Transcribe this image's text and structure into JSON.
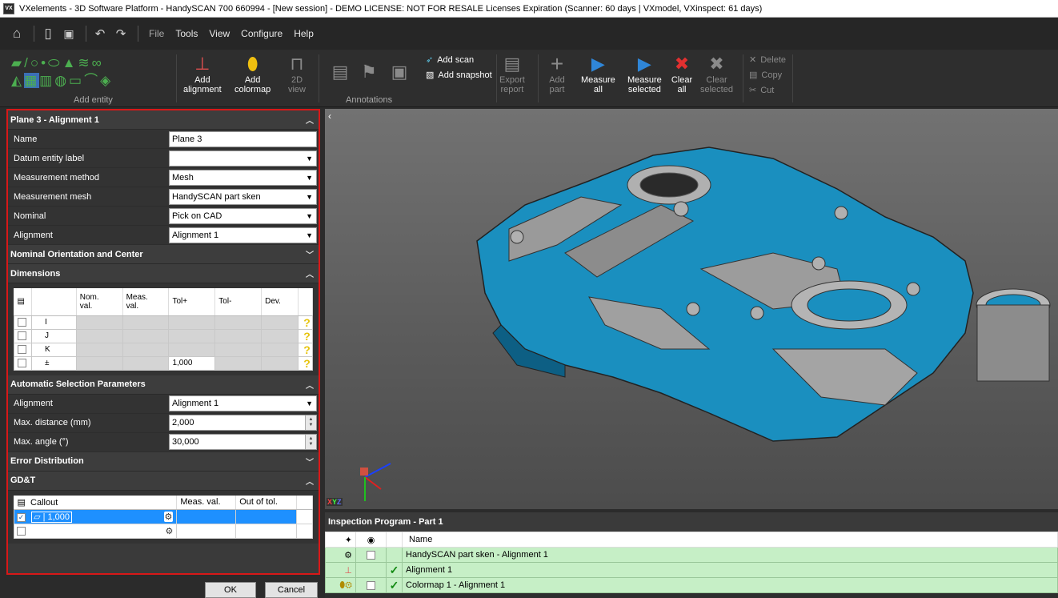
{
  "window": {
    "title": "VXelements - 3D Software Platform - HandySCAN 700 660994 - [New session] - DEMO LICENSE: NOT FOR RESALE Licenses Expiration (Scanner: 60 days | VXmodel, VXinspect: 61 days)",
    "icon": "VX"
  },
  "menu": {
    "items": [
      "File",
      "Tools",
      "View",
      "Configure",
      "Help"
    ],
    "icons": [
      "home-icon",
      "new-document-icon",
      "save-icon",
      "undo-icon",
      "redo-icon"
    ]
  },
  "ribbon": {
    "add_entity_label": "Add entity",
    "add_alignment": "Add\nalignment",
    "add_colormap": "Add\ncolormap",
    "view_2d": "2D\nview",
    "annotations_label": "Annotations",
    "add_scan": "Add scan",
    "add_snapshot": "Add snapshot",
    "export_report": "Export\nreport",
    "add_part": "Add\npart",
    "measure_all": "Measure\nall",
    "measure_selected": "Measure\nselected",
    "clear_all": "Clear\nall",
    "clear_selected": "Clear\nselected",
    "delete": "Delete",
    "copy": "Copy",
    "cut": "Cut"
  },
  "panel": {
    "header": "Plane 3 - Alignment 1",
    "properties": [
      {
        "label": "Name",
        "value": "Plane 3",
        "type": "text"
      },
      {
        "label": "Datum entity label",
        "value": "",
        "type": "dropdown"
      },
      {
        "label": "Measurement method",
        "value": "Mesh",
        "type": "dropdown"
      },
      {
        "label": "Measurement mesh",
        "value": "HandySCAN part sken",
        "type": "dropdown"
      },
      {
        "label": "Nominal",
        "value": "Pick on CAD",
        "type": "dropdown"
      },
      {
        "label": "Alignment",
        "value": "Alignment 1",
        "type": "dropdown"
      }
    ],
    "nominal_section": "Nominal Orientation and Center",
    "dimensions_section": "Dimensions",
    "dimensions_table": {
      "columns": [
        "Nom.\nval.",
        "Meas.\nval.",
        "Tol+",
        "Tol-",
        "Dev."
      ],
      "rows": [
        {
          "label": "I",
          "tol_plus": ""
        },
        {
          "label": "J",
          "tol_plus": ""
        },
        {
          "label": "K",
          "tol_plus": ""
        },
        {
          "label": "±",
          "tol_plus": "1,000"
        }
      ]
    },
    "auto_section": "Automatic Selection Parameters",
    "auto_params": [
      {
        "label": "Alignment",
        "value": "Alignment 1",
        "type": "dropdown"
      },
      {
        "label": "Max. distance (mm)",
        "value": "2,000",
        "type": "spin"
      },
      {
        "label": "Max. angle (°)",
        "value": "30,000",
        "type": "spin"
      }
    ],
    "error_section": "Error Distribution",
    "gdt_section": "GD&T",
    "gdt_table": {
      "columns": [
        "Callout",
        "Meas. val.",
        "Out of tol."
      ],
      "rows": [
        {
          "callout": "1,000",
          "checked": true,
          "selected": true
        },
        {
          "callout": "",
          "checked": false,
          "selected": false
        }
      ]
    },
    "ok": "OK",
    "cancel": "Cancel"
  },
  "viewport": {
    "axes_label_x": "X",
    "axes_label_y": "Y",
    "axes_label_z": "Z"
  },
  "inspection": {
    "title": "Inspection Program - Part 1",
    "name_col": "Name",
    "rows": [
      {
        "name": "HandySCAN part sken - Alignment 1",
        "check": false
      },
      {
        "name": "Alignment 1",
        "check": true
      },
      {
        "name": "Colormap 1 - Alignment 1",
        "check": true
      }
    ]
  },
  "colors": {
    "accent_blue": "#1e90ff",
    "highlight_red": "#d81818",
    "part_blue": "#1a8fbf",
    "row_green": "#c6efc6"
  }
}
